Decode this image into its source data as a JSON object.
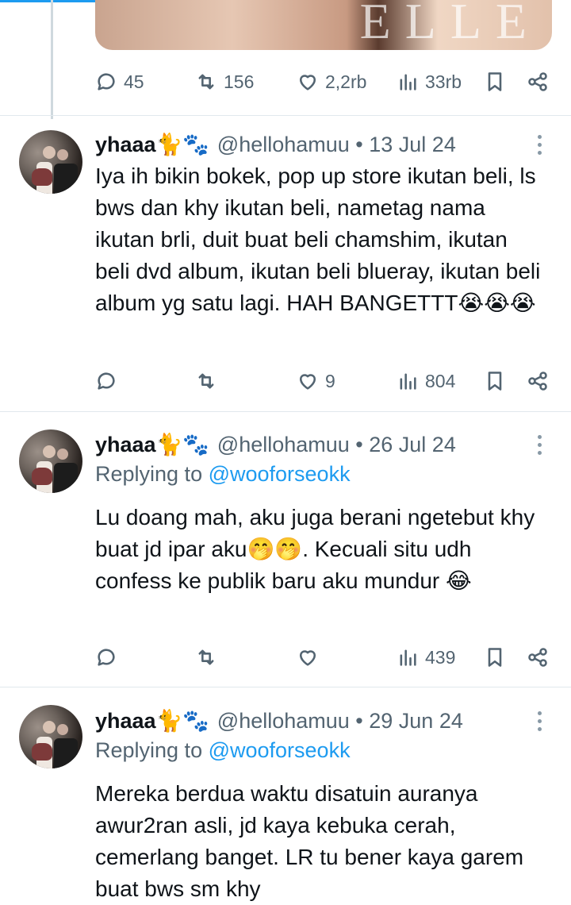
{
  "top": {
    "media_text": "ELLE",
    "stats": {
      "replies": "45",
      "retweets": "156",
      "likes": "2,2rb",
      "views": "33rb"
    }
  },
  "tweets": [
    {
      "name": "yhaaa🐈🐾",
      "handle": "@hellohamuu • 13 Jul 24",
      "replying_prefix": "",
      "replying_to": "",
      "text": "Iya ih bikin bokek, pop up store ikutan beli, ls bws dan khy ikutan beli, nametag nama ikutan brli, duit buat beli chamshim, ikutan beli dvd album, ikutan beli blueray, ikutan beli album yg satu lagi. HAH BANGETTT😭😭😭",
      "stats": {
        "replies": "",
        "retweets": "",
        "likes": "9",
        "views": "804"
      }
    },
    {
      "name": "yhaaa🐈🐾",
      "handle": "@hellohamuu • 26 Jul 24",
      "replying_prefix": "Replying to ",
      "replying_to": "@wooforseokk",
      "text": "Lu doang mah, aku juga berani ngetebut khy buat jd ipar aku🤭🤭. Kecuali situ udh confess ke publik baru aku mundur 😂",
      "stats": {
        "replies": "",
        "retweets": "",
        "likes": "",
        "views": "439"
      }
    },
    {
      "name": "yhaaa🐈🐾",
      "handle": "@hellohamuu • 29 Jun 24",
      "replying_prefix": "Replying to ",
      "replying_to": "@wooforseokk",
      "text": "Mereka berdua waktu disatuin auranya awur2ran asli, jd kaya kebuka cerah, cemerlang banget. LR tu bener kaya garem buat bws sm khy",
      "stats": {
        "replies": "",
        "retweets": "",
        "likes": "",
        "views": ""
      }
    }
  ],
  "icons": {
    "reply": "reply-icon",
    "retweet": "retweet-icon",
    "like": "heart-icon",
    "views": "views-icon",
    "bookmark": "bookmark-icon",
    "share": "share-icon",
    "more": "more-icon"
  },
  "colors": {
    "link": "#1d9bf0",
    "muted": "#536471",
    "text": "#0f1419",
    "separator": "#e1e8ed"
  }
}
